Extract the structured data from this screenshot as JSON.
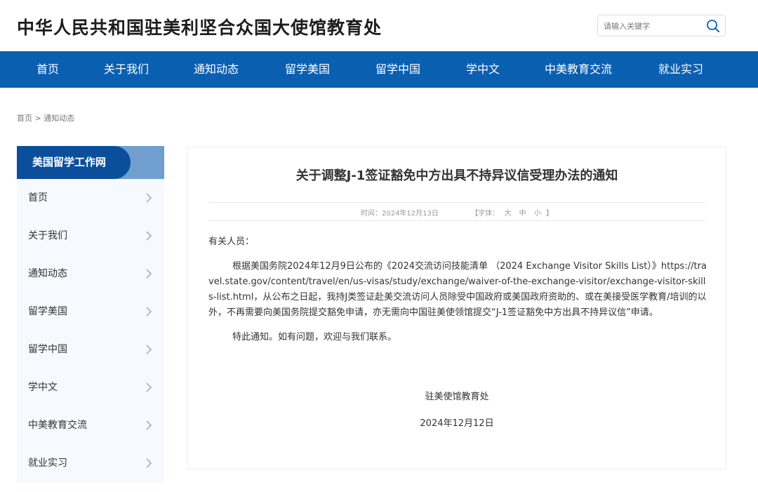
{
  "header": {
    "site_title": "中华人民共和国驻美利坚合众国大使馆教育处",
    "search_placeholder": "请输入关键字",
    "search_icon": "search-icon"
  },
  "nav": {
    "items": [
      {
        "label": "首页"
      },
      {
        "label": "关于我们"
      },
      {
        "label": "通知动态"
      },
      {
        "label": "留学美国"
      },
      {
        "label": "留学中国"
      },
      {
        "label": "学中文"
      },
      {
        "label": "中美教育交流"
      },
      {
        "label": "就业实习"
      }
    ]
  },
  "breadcrumb": {
    "home": "首页",
    "separator": ">",
    "current": "通知动态"
  },
  "sidebar": {
    "title": "美国留学工作网",
    "items": [
      {
        "label": "首页"
      },
      {
        "label": "关于我们"
      },
      {
        "label": "通知动态"
      },
      {
        "label": "留学美国"
      },
      {
        "label": "留学中国"
      },
      {
        "label": "学中文"
      },
      {
        "label": "中美教育交流"
      },
      {
        "label": "就业实习"
      }
    ]
  },
  "article": {
    "title": "关于调整J-1签证豁免中方出具不持异议信受理办法的通知",
    "meta": {
      "time_label": "时间：",
      "time_value": "2024年12月13日",
      "font_label": "【字体：",
      "size_large": "大",
      "size_medium": "中",
      "size_small": "小",
      "font_close": "】"
    },
    "greeting": "有关人员：",
    "para1_a": "根据美国务院2024年12月9日公布的《2024交流访问技能清单 （2024 Exchange Visitor Skills List）》",
    "para1_url": "https://travel.state.gov/content/travel/en/us-visas/study/exchange/waiver-of-the-exchange-visitor/exchange-visitor-skills-list.html",
    "para1_b": "，从公布之日起，我持J类签证赴美交流访问人员除受中国政府或美国政府资助的、或在美接受医学教育/培训的以外，不再需要向美国务院提交豁免申请，亦无需向中国驻美使领馆提交“J-1签证豁免中方出具不持异议信”申请。",
    "notice": "特此通知。如有问题，欢迎与我们联系。",
    "signature": "驻美使馆教育处",
    "date": "2024年12月12日"
  },
  "colors": {
    "nav_bg": "#0b5fb0",
    "sidebar_head": "#0b4f9c",
    "sidebar_head_light": "#6f9ecf",
    "sidebar_bg": "#f6f9fd"
  }
}
